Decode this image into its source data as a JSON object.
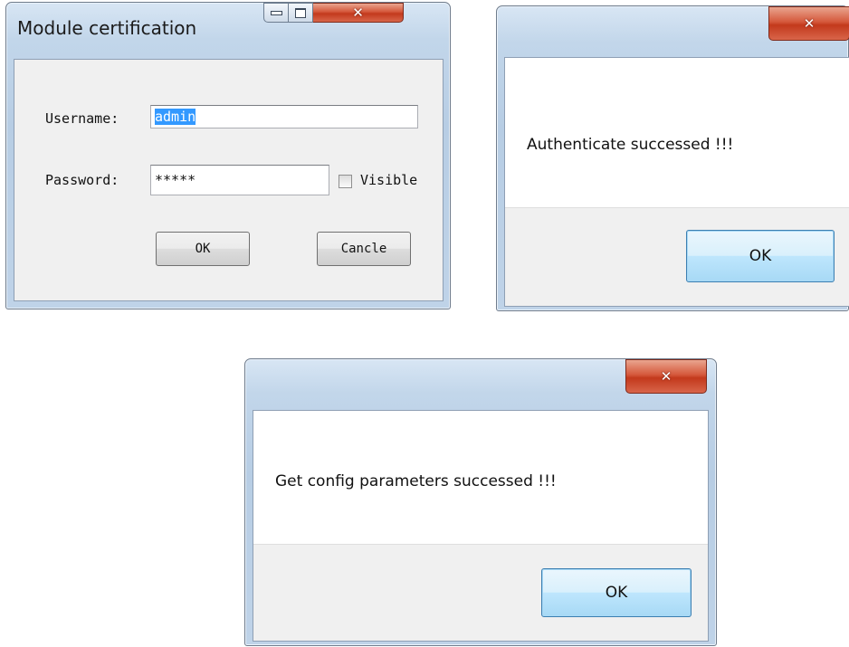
{
  "login_dialog": {
    "title": "Module certification",
    "username_label": "Username:",
    "username_value": "admin",
    "password_label": "Password:",
    "password_value": "*****",
    "visible_label": "Visible",
    "ok_label": "OK",
    "cancel_label": "Cancle"
  },
  "auth_dialog": {
    "message": "Authenticate successed !!!",
    "ok_label": "OK"
  },
  "config_dialog": {
    "message": "Get config parameters successed !!!",
    "ok_label": "OK"
  },
  "icons": {
    "close": "close-icon",
    "minimize": "minimize-icon",
    "maximize": "maximize-icon"
  }
}
